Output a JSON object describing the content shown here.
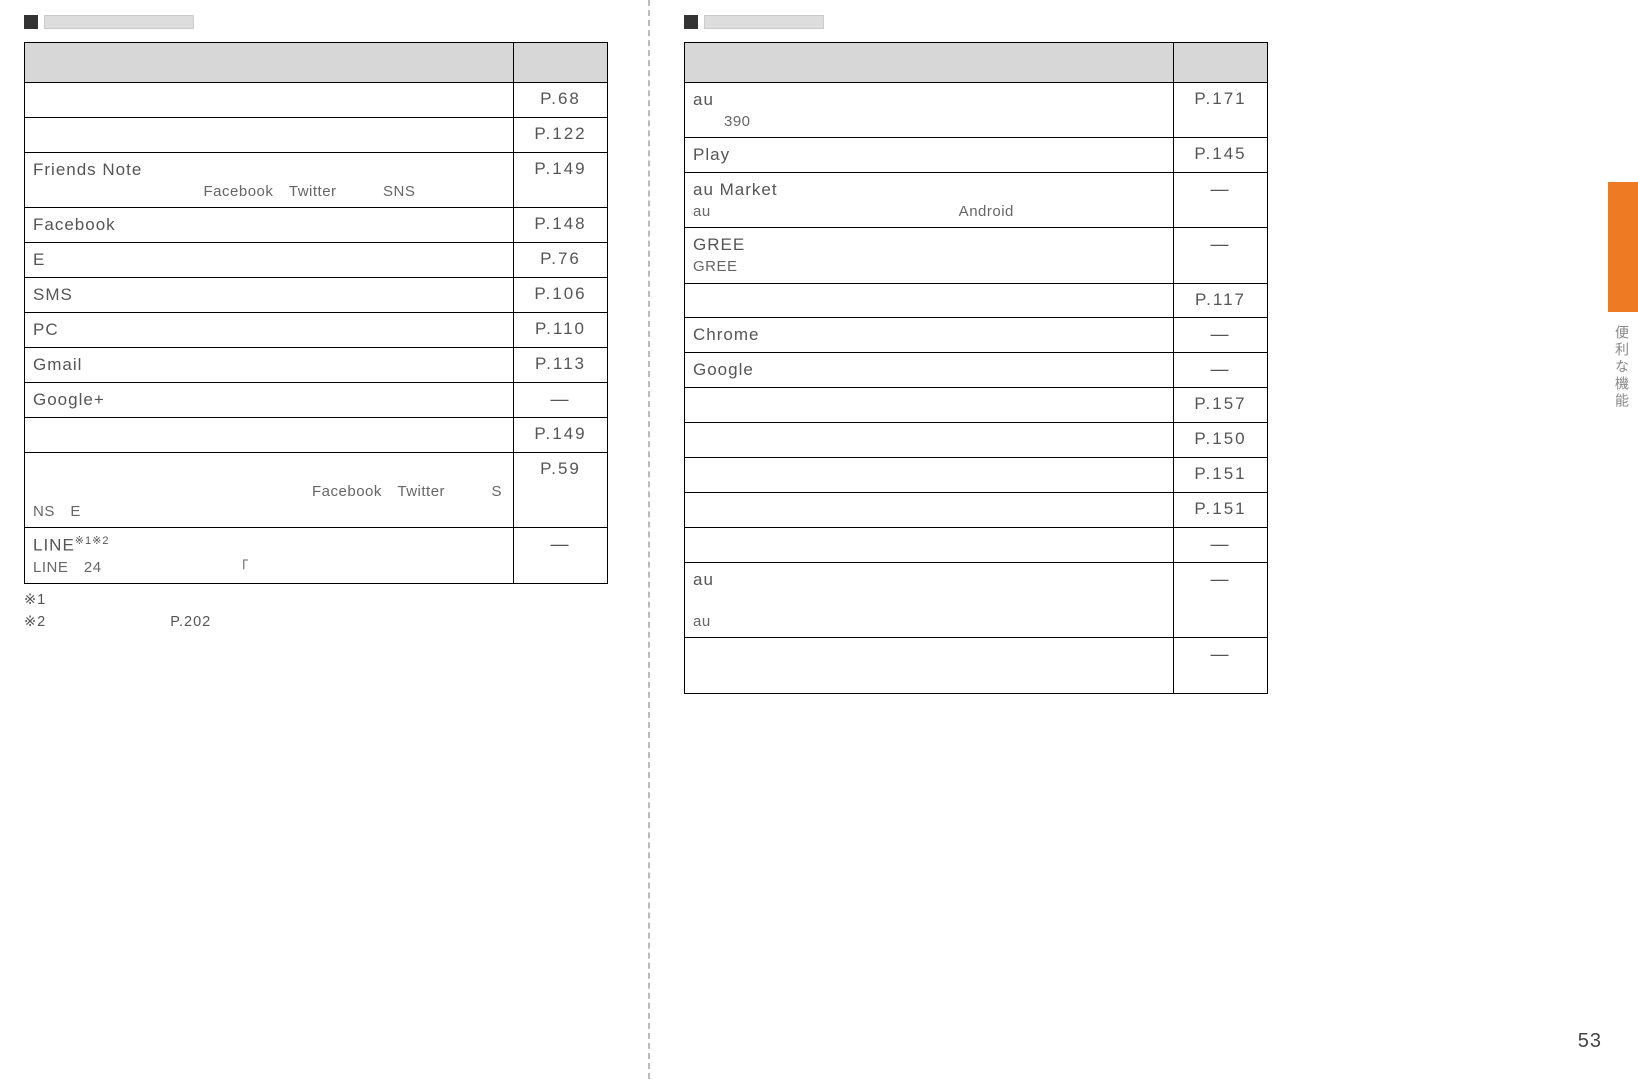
{
  "page_number": "53",
  "side_tab_text": "便利な機能",
  "left": {
    "heading_marker": "■",
    "heading_blank": "　　　　　　　　　",
    "table_header_left": "　",
    "table_header_right": "　",
    "rows": [
      {
        "name": "　",
        "desc": "",
        "ref": "P.68"
      },
      {
        "name": "　",
        "desc": "",
        "ref": "P.122"
      },
      {
        "name": "Friends Note",
        "desc": "　　　　　　　　　　　Facebook　Twitter　　　SNS　　　",
        "ref": "P.149"
      },
      {
        "name": "Facebook",
        "desc": "",
        "ref": "P.148"
      },
      {
        "name": "E　　",
        "desc": "",
        "ref": "P.76"
      },
      {
        "name": "SMS",
        "desc": "",
        "ref": "P.106"
      },
      {
        "name": "PC　　",
        "desc": "",
        "ref": "P.110"
      },
      {
        "name": "Gmail",
        "desc": "",
        "ref": "P.113"
      },
      {
        "name": "Google+",
        "desc": "",
        "ref": "—"
      },
      {
        "name": "　",
        "desc": "",
        "ref": "P.149"
      },
      {
        "name": "　",
        "desc": "\n　　　　　　　　　　　　　　　　　　Facebook　Twitter　　　SNS　E　　　　　　　　　　　",
        "ref": "P.59"
      },
      {
        "name": "LINE",
        "sup": "※1※2",
        "desc": "LINE　24　　　　　　　　　「　　　　　　　　　\n　　　　　　　　　　　　　",
        "ref": "—"
      }
    ],
    "footnote1": "※1　　　　　　　　　　　　　　　　　　　　",
    "footnote2": "※2　　　　　　　　P.202　　　　　　　　　"
  },
  "right": {
    "heading_marker": "■",
    "heading_blank": "　　　　　　　",
    "table_header_left": "　",
    "table_header_right": "　",
    "rows": [
      {
        "name": "au　　　",
        "desc": "　　390　　　　　　　　　　　　　　　　　　　　　　　　　　　　　　　　　　　　　　　　　　　　　　　　　　　　　　　　　　　　　　　　　　　　　　　　　",
        "ref": "P.171"
      },
      {
        "name": "Play　　",
        "desc": "",
        "ref": "P.145"
      },
      {
        "name": "au Market",
        "desc": "au　　　　　　　　　　　　　　　　Android　　　　　\n　　　　　　",
        "ref": "—"
      },
      {
        "name": "GREE　　　",
        "desc": "GREE　　　　　　　　　　　　　　　　　　　　　　　　　　　　　　　　　　　　　　　　　　　　　　　　　　　　　　　　　　　　　　",
        "ref": "—"
      },
      {
        "name": "　",
        "desc": "",
        "ref": "P.117"
      },
      {
        "name": "Chrome",
        "desc": "",
        "ref": "—"
      },
      {
        "name": "Google",
        "desc": "",
        "ref": "—"
      },
      {
        "name": "　",
        "desc": "",
        "ref": "P.157"
      },
      {
        "name": "　",
        "desc": "",
        "ref": "P.150"
      },
      {
        "name": "　",
        "desc": "",
        "ref": "P.151"
      },
      {
        "name": "　",
        "desc": "",
        "ref": "P.151"
      },
      {
        "name": "　",
        "desc": "",
        "ref": "—"
      },
      {
        "name": "au　　　　　　　",
        "desc": "　　　　　　　　　　　　　　　　　　　　　　　　　　　　　　　　　　　　au　　　　　　　　　　　　　　　",
        "ref": "—"
      },
      {
        "name": "　",
        "desc": "　　　　　　　　　　　　　　　　　　　　　　　　　　　　　",
        "ref": "—"
      }
    ]
  }
}
